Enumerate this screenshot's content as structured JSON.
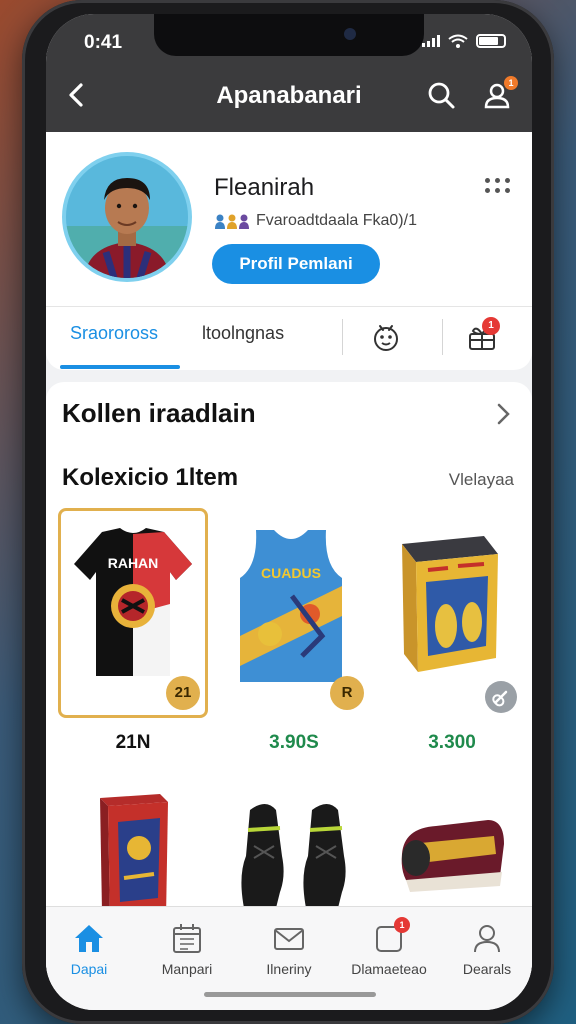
{
  "status": {
    "time": "0:41"
  },
  "header": {
    "title": "Apanabanari",
    "back_icon": "chevron-left-icon",
    "search_icon": "search-icon",
    "user_icon": "user-icon",
    "badge": "1"
  },
  "profile": {
    "name": "Fleanirah",
    "subtitle": "Fvaroadtdaala Fka0)/1",
    "button": "Profil Pemlani"
  },
  "tabs": [
    {
      "label": "Sraoroross"
    },
    {
      "label": "ltoolngnas"
    }
  ],
  "tab_badge": "1",
  "collection": {
    "title": "Kollen iraadlain",
    "subtitle": "Kolexicio 1ltem",
    "link": "Vlelayaa"
  },
  "items": [
    {
      "name": "jersey-item",
      "price": "21N",
      "badge": "21",
      "selected": true,
      "jersey_text": "RAHAN"
    },
    {
      "name": "tank-jersey-item",
      "price": "3.90S",
      "badge": "R",
      "selected": false,
      "jersey_text": "CUADUS"
    },
    {
      "name": "box-item",
      "price": "3.300",
      "badge": "",
      "selected": false
    }
  ],
  "bottom_nav": [
    {
      "label": "Dapai",
      "icon": "home-icon",
      "active": true
    },
    {
      "label": "Manpari",
      "icon": "calendar-icon",
      "active": false
    },
    {
      "label": "Ilneriny",
      "icon": "mail-icon",
      "active": false
    },
    {
      "label": "Dlamaeteao",
      "icon": "notification-icon",
      "active": false,
      "badge": "1"
    },
    {
      "label": "Dearals",
      "icon": "profile-icon",
      "active": false
    }
  ],
  "colors": {
    "accent": "#1a8fe3",
    "price_green": "#1f8a4c",
    "badge_gold": "#e1b04e",
    "header": "#3b3b3d"
  }
}
